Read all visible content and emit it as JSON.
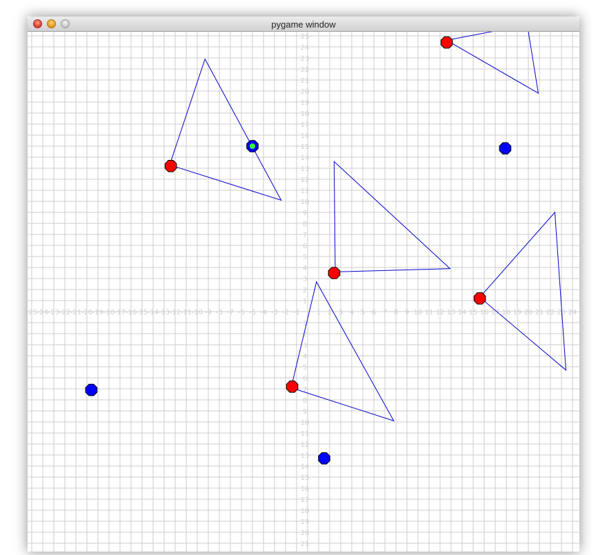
{
  "window": {
    "title": "pygame window"
  },
  "colors": {
    "grid": "#cccccc",
    "axis_labels": "#cfcfcf",
    "triangle_edge": "#0000cc",
    "robot_red": "#ff0000",
    "robot_blue": "#0000ff",
    "target_green": "#33ff33"
  },
  "buttons": {
    "close": "close-button",
    "minimize": "minimize-button",
    "zoom": "zoom-button"
  },
  "plot": {
    "x_range": [
      -25,
      24
    ],
    "y_range": [
      -21,
      25
    ]
  },
  "triangles": [
    {
      "points": [
        [
          -12.5,
          13.3
        ],
        [
          -9.3,
          22.9
        ],
        [
          -2.4,
          10.1
        ]
      ]
    },
    {
      "points": [
        [
          2.5,
          3.6
        ],
        [
          2.4,
          13.6
        ],
        [
          12.9,
          3.9
        ]
      ]
    },
    {
      "points": [
        [
          -1.5,
          -6.9
        ],
        [
          0.8,
          2.7
        ],
        [
          7.8,
          -9.9
        ]
      ]
    },
    {
      "points": [
        [
          15.6,
          1.3
        ],
        [
          22.4,
          9.0
        ],
        [
          23.4,
          -5.3
        ]
      ]
    },
    {
      "points": [
        [
          12.6,
          24.6
        ],
        [
          20.9,
          19.8
        ],
        [
          19.9,
          26.0
        ]
      ]
    }
  ],
  "red_markers": [
    [
      -12.4,
      13.2
    ],
    [
      2.4,
      3.5
    ],
    [
      -1.4,
      -6.8
    ],
    [
      15.6,
      1.2
    ],
    [
      12.6,
      24.4
    ]
  ],
  "blue_markers": [
    [
      -5.0,
      15.0
    ],
    [
      17.9,
      14.8
    ],
    [
      -19.6,
      -7.1
    ],
    [
      1.5,
      -13.3
    ]
  ],
  "target_markers": [
    [
      -5.0,
      15.0
    ]
  ]
}
